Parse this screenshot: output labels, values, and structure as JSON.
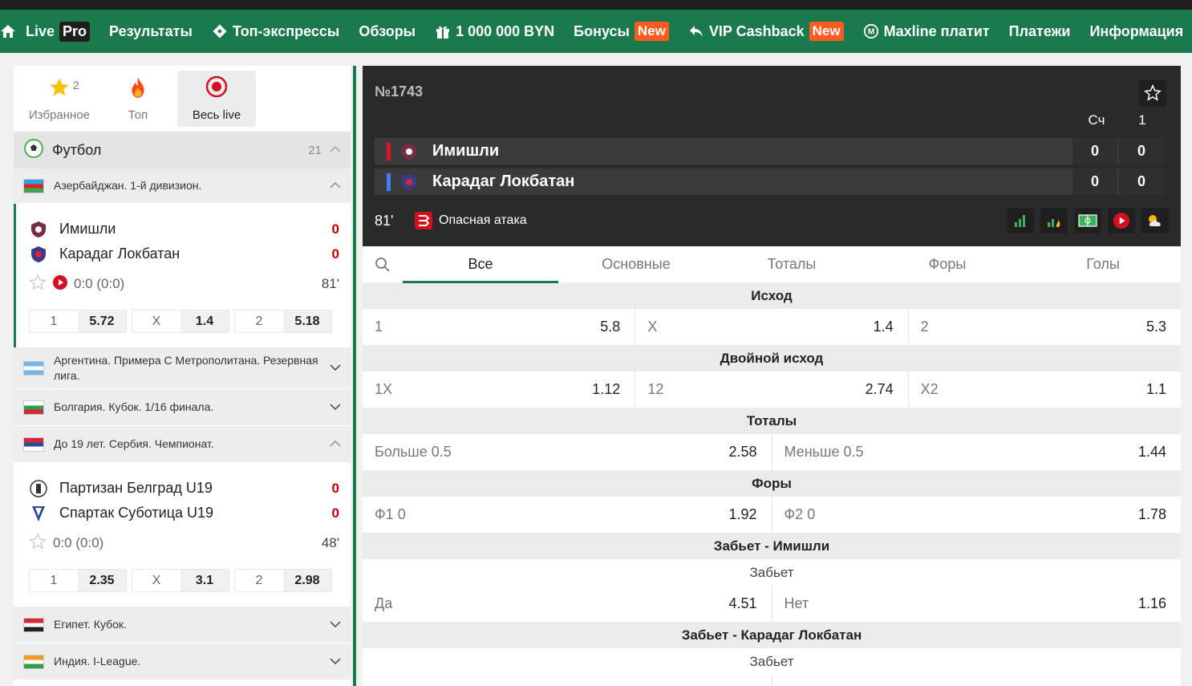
{
  "nav": {
    "items": [
      {
        "label": "Live",
        "badge": "Pro",
        "badge_type": "pro",
        "icon": ""
      },
      {
        "label": "Результаты",
        "badge": "",
        "icon": ""
      },
      {
        "label": "Топ-экспрессы",
        "badge": "",
        "icon": "ticket-icon"
      },
      {
        "label": "Обзоры",
        "badge": "",
        "icon": ""
      },
      {
        "label": "1 000 000 BYN",
        "badge": "",
        "icon": "gift-icon"
      },
      {
        "label": "Бонусы",
        "badge": "New",
        "badge_type": "new",
        "icon": ""
      },
      {
        "label": "VIP Cashback",
        "badge": "New",
        "badge_type": "new",
        "icon": "return-arrow-icon"
      },
      {
        "label": "Maxline платит",
        "badge": "",
        "icon": "maxline-logo-icon"
      },
      {
        "label": "Платежи",
        "badge": "",
        "icon": ""
      },
      {
        "label": "Информация",
        "badge": "",
        "icon": ""
      }
    ]
  },
  "filters": {
    "favorites_label": "Избранное",
    "favorites_count": "2",
    "top_label": "Топ",
    "all_live_label": "Весь live"
  },
  "sport": {
    "name": "Футбол",
    "count": "21"
  },
  "leagues": {
    "aze": "Азербайджан. 1-й дивизион.",
    "arg": "Аргентина. Примера С Метрополитана. Резервная лига.",
    "bul": "Болгария. Кубок. 1/16 финала.",
    "srb": "До 19 лет. Сербия. Чемпионат.",
    "egy": "Египет. Кубок.",
    "ind": "Индия. I-League."
  },
  "match1": {
    "home": "Имишли",
    "away": "Карадаг Локбатан",
    "home_score": "0",
    "away_score": "0",
    "score": "0:0 (0:0)",
    "minute": "81'",
    "odds": [
      {
        "label": "1",
        "value": "5.72"
      },
      {
        "label": "X",
        "value": "1.4"
      },
      {
        "label": "2",
        "value": "5.18"
      }
    ]
  },
  "match2": {
    "home": "Партизан Белград U19",
    "away": "Спартак Суботица U19",
    "home_score": "0",
    "away_score": "0",
    "score": "0:0 (0:0)",
    "minute": "48'",
    "odds": [
      {
        "label": "1",
        "value": "2.35"
      },
      {
        "label": "X",
        "value": "3.1"
      },
      {
        "label": "2",
        "value": "2.98"
      }
    ]
  },
  "scoreboard": {
    "number": "№1743",
    "col_total": "Сч",
    "col_period": "1",
    "home": "Имишли",
    "away": "Карадаг Локбатан",
    "home_total": "0",
    "home_p1": "0",
    "away_total": "0",
    "away_p1": "0",
    "minute": "81'",
    "event": "Опасная атака",
    "home_color": "#e0102a",
    "away_color": "#3b82f6"
  },
  "market_tabs": [
    "Все",
    "Основные",
    "Тоталы",
    "Форы",
    "Голы"
  ],
  "markets": {
    "outcome": {
      "title": "Исход",
      "cells": [
        {
          "l": "1",
          "v": "5.8"
        },
        {
          "l": "X",
          "v": "1.4"
        },
        {
          "l": "2",
          "v": "5.3"
        }
      ]
    },
    "double": {
      "title": "Двойной исход",
      "cells": [
        {
          "l": "1X",
          "v": "1.12"
        },
        {
          "l": "12",
          "v": "2.74"
        },
        {
          "l": "X2",
          "v": "1.1"
        }
      ]
    },
    "totals": {
      "title": "Тоталы",
      "cells": [
        {
          "l": "Больше 0.5",
          "v": "2.58"
        },
        {
          "l": "Меньше 0.5",
          "v": "1.44"
        }
      ]
    },
    "handicap": {
      "title": "Форы",
      "cells": [
        {
          "l": "Ф1 0",
          "v": "1.92"
        },
        {
          "l": "Ф2 0",
          "v": "1.78"
        }
      ]
    },
    "home_scores": {
      "title": "Забьет - Имишли",
      "sub": "Забьет",
      "cells": [
        {
          "l": "Да",
          "v": "4.51"
        },
        {
          "l": "Нет",
          "v": "1.16"
        }
      ]
    },
    "away_scores": {
      "title": "Забьет - Карадаг Локбатан",
      "sub": "Забьет"
    }
  },
  "colors": {
    "brand": "#1b7a4d",
    "accent_new": "#ff5a1f",
    "score_red": "#c40000"
  }
}
